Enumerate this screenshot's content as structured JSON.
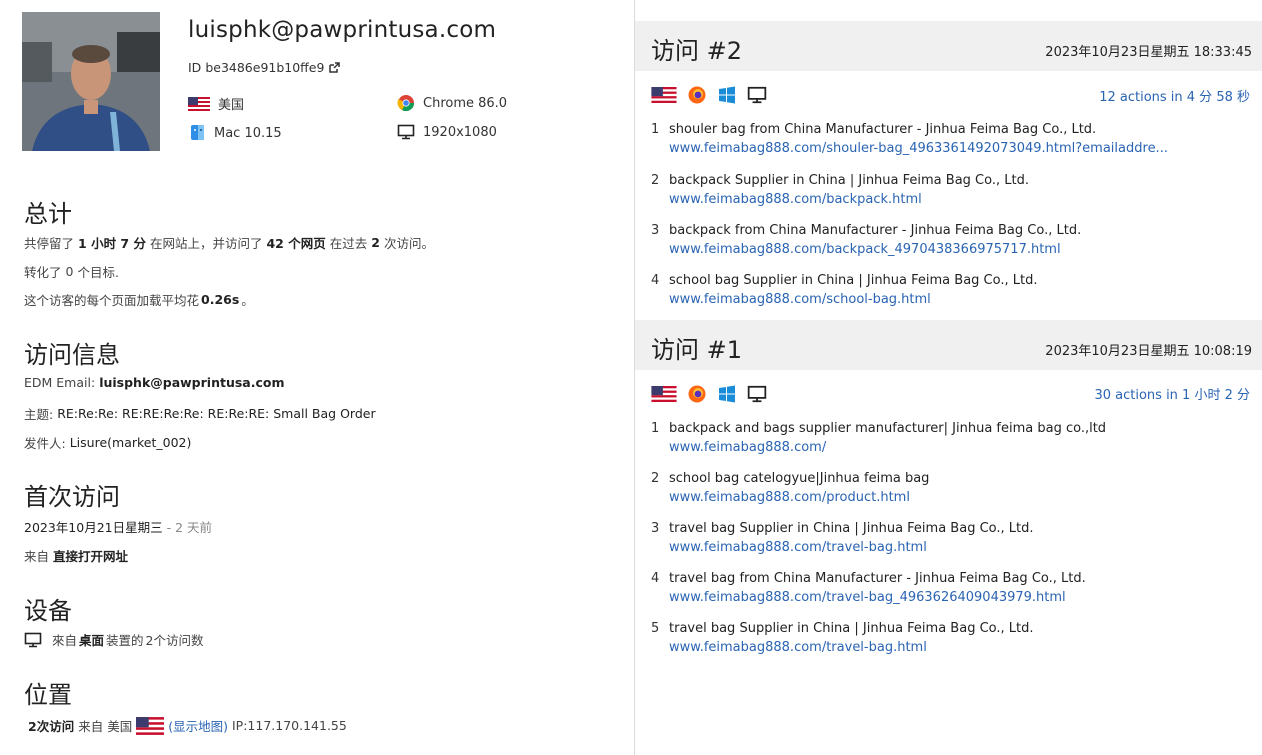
{
  "profile": {
    "email": "luisphk@pawprintusa.com",
    "id_label": "ID",
    "id_value": "be3486e91b10ffe9",
    "country": "美国",
    "os": "Mac 10.15",
    "browser": "Chrome 86.0",
    "resolution": "1920x1080"
  },
  "summary": {
    "title": "总计",
    "line1_a": "共停留了",
    "line1_time": "1 小时 7 分",
    "line1_b": "在网站上，并访问了",
    "line1_pages": "42 个网页",
    "line1_c": "在过去",
    "line1_visits": "2",
    "line1_d": "次访问。",
    "line2_a": "转化了",
    "line2_count": "0",
    "line2_b": "个目标.",
    "line3_a": "这个访客的每个页面加载平均花",
    "line3_time": "0.26s",
    "line3_b": "。"
  },
  "visit_info": {
    "title": "访问信息",
    "edm_label": "EDM Email:",
    "edm_value": "luisphk@pawprintusa.com",
    "subject_label": "主题:",
    "subject_value": "RE:Re:Re: RE:RE:Re:Re: RE:Re:RE: Small Bag Order",
    "sender_label": "发件人:",
    "sender_value": "Lisure(market_002)"
  },
  "first_visit": {
    "title": "首次访问",
    "date": "2023年10月21日星期三",
    "ago": "- 2 天前",
    "from_label": "来自",
    "from_value": "直接打开网址"
  },
  "device": {
    "title": "设备",
    "text_a": "來自",
    "text_b": "桌面",
    "text_c": "装置的",
    "text_d": "2个访问数"
  },
  "location": {
    "title": "位置",
    "visits": "2次访问",
    "from": "来自",
    "country": "美国",
    "map_link": "(显示地图)",
    "ip": "IP:117.170.141.55"
  },
  "visits": [
    {
      "title": "访问 #2",
      "date": "2023年10月23日星期五",
      "time": "18:33:45",
      "actions": "12 actions in 4 分 58 秒",
      "pages": [
        {
          "num": "1",
          "title": "shouler bag from China Manufacturer - Jinhua Feima Bag Co., Ltd.",
          "url": "www.feimabag888.com/shouler-bag_4963361492073049.html?emailaddre..."
        },
        {
          "num": "2",
          "title": "backpack Supplier in China | Jinhua Feima Bag Co., Ltd.",
          "url": "www.feimabag888.com/backpack.html"
        },
        {
          "num": "3",
          "title": "backpack from China Manufacturer - Jinhua Feima Bag Co., Ltd.",
          "url": "www.feimabag888.com/backpack_4970438366975717.html"
        },
        {
          "num": "4",
          "title": "school bag Supplier in China | Jinhua Feima Bag Co., Ltd.",
          "url": "www.feimabag888.com/school-bag.html"
        }
      ]
    },
    {
      "title": "访问 #1",
      "date": "2023年10月23日星期五",
      "time": "10:08:19",
      "actions": "30 actions in 1 小时 2 分",
      "pages": [
        {
          "num": "1",
          "title": "backpack and bags supplier manufacturer| Jinhua feima bag co.,ltd",
          "url": "www.feimabag888.com/"
        },
        {
          "num": "2",
          "title": "school bag catelogyue|Jinhua feima bag",
          "url": "www.feimabag888.com/product.html"
        },
        {
          "num": "3",
          "title": "travel bag Supplier in China | Jinhua Feima Bag Co., Ltd.",
          "url": "www.feimabag888.com/travel-bag.html"
        },
        {
          "num": "4",
          "title": "travel bag from China Manufacturer - Jinhua Feima Bag Co., Ltd.",
          "url": "www.feimabag888.com/travel-bag_4963626409043979.html"
        },
        {
          "num": "5",
          "title": "travel bag Supplier in China | Jinhua Feima Bag Co., Ltd.",
          "url": "www.feimabag888.com/travel-bag.html"
        }
      ]
    }
  ],
  "icons": {
    "flag": "us-flag-icon",
    "browser": "firefox-icon",
    "os": "windows-icon",
    "device": "desktop-icon"
  }
}
